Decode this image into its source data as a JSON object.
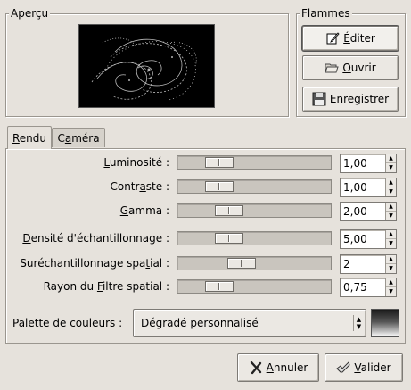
{
  "preview": {
    "title": "Aperçu"
  },
  "flames": {
    "title": "Flammes",
    "edit_label_pre": "",
    "edit_label_u": "É",
    "edit_label_post": "diter",
    "open_label_pre": "",
    "open_label_u": "O",
    "open_label_post": "uvrir",
    "save_label_pre": "",
    "save_label_u": "E",
    "save_label_post": "nregistrer"
  },
  "tabs": [
    {
      "label_u": "R",
      "label_post": "endu",
      "active": true
    },
    {
      "label_pre": "C",
      "label_u": "a",
      "label_post": "méra",
      "active": false
    }
  ],
  "rows": [
    {
      "label_pre": "",
      "label_u": "L",
      "label_post": "uminosité :",
      "value": "1,00",
      "fraction": 0.22
    },
    {
      "label_pre": "Contr",
      "label_u": "a",
      "label_post": "ste :",
      "value": "1,00",
      "fraction": 0.22
    },
    {
      "label_pre": "",
      "label_u": "G",
      "label_post": "amma :",
      "value": "2,00",
      "fraction": 0.3
    },
    {
      "label_pre": "",
      "label_u": "D",
      "label_post": "ensité d'échantillonnage :",
      "value": "5,00",
      "fraction": 0.3
    },
    {
      "label_pre": "Suréchantillonnage spa",
      "label_u": "t",
      "label_post": "ial :",
      "value": "2",
      "fraction": 0.4
    },
    {
      "label_pre": "Rayon du ",
      "label_u": "F",
      "label_post": "iltre spatial :",
      "value": "0,75",
      "fraction": 0.22
    }
  ],
  "palette": {
    "label_pre": "",
    "label_u": "P",
    "label_post": "alette de couleurs :",
    "selected": "Dégradé personnalisé"
  },
  "buttons": {
    "cancel_u": "A",
    "cancel_post": "nnuler",
    "ok_u": "V",
    "ok_post": "alider"
  }
}
